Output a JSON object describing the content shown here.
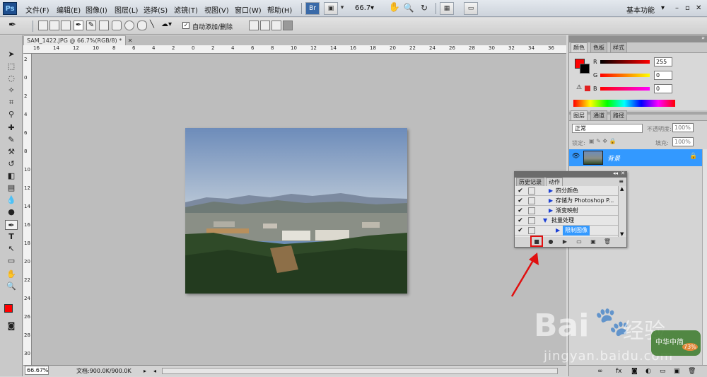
{
  "app": {
    "logo": "Ps"
  },
  "menu": {
    "items": [
      "文件(F)",
      "编辑(E)",
      "图像(I)",
      "图层(L)",
      "选择(S)",
      "滤镜(T)",
      "视图(V)",
      "窗口(W)",
      "帮助(H)"
    ],
    "zoom": "66.7",
    "workspace": "基本功能"
  },
  "options": {
    "auto_add_delete": "自动添加/删除"
  },
  "document": {
    "tab_title": "SAM_1422.JPG @ 66.7%(RGB/8) *",
    "ruler_h": [
      "16",
      "14",
      "12",
      "10",
      "8",
      "6",
      "4",
      "2",
      "0",
      "2",
      "4",
      "6",
      "8",
      "10",
      "12",
      "14",
      "16",
      "18",
      "20",
      "22",
      "24",
      "26",
      "28",
      "30",
      "32",
      "34",
      "36"
    ],
    "ruler_v": [
      "2",
      "0",
      "2",
      "4",
      "6",
      "8",
      "10",
      "12",
      "14",
      "16",
      "18",
      "20",
      "22",
      "24",
      "26",
      "28",
      "30"
    ]
  },
  "status": {
    "zoom": "66.67%",
    "doc_size": "文档:900.0K/900.0K"
  },
  "color_panel": {
    "tabs": [
      "颜色",
      "色板",
      "样式"
    ],
    "r": {
      "label": "R",
      "value": "255"
    },
    "g": {
      "label": "G",
      "value": "0"
    },
    "b": {
      "label": "B",
      "value": "0"
    }
  },
  "layers_panel": {
    "tabs": [
      "图层",
      "通道",
      "路径"
    ],
    "blend_mode": "正常",
    "opacity_label": "不透明度:",
    "opacity": "100%",
    "lock_label": "锁定:",
    "fill_label": "填充:",
    "fill": "100%",
    "layer_name": "背景"
  },
  "actions_panel": {
    "tabs": [
      "历史记录",
      "动作"
    ],
    "rows": [
      "四分颜色",
      "存储为 Photoshop P...",
      "渐变映射",
      "批量处理",
      "限制图像"
    ]
  },
  "watermark": {
    "brand": "Bai",
    "brand_cn": "经验",
    "url": "jingyan.baidu.com",
    "badge_text": "中华中简",
    "badge_num": "73%"
  },
  "colors": {
    "accent": "#3399ff",
    "foreground": "#ff0000",
    "highlight_box": "#e01010"
  }
}
